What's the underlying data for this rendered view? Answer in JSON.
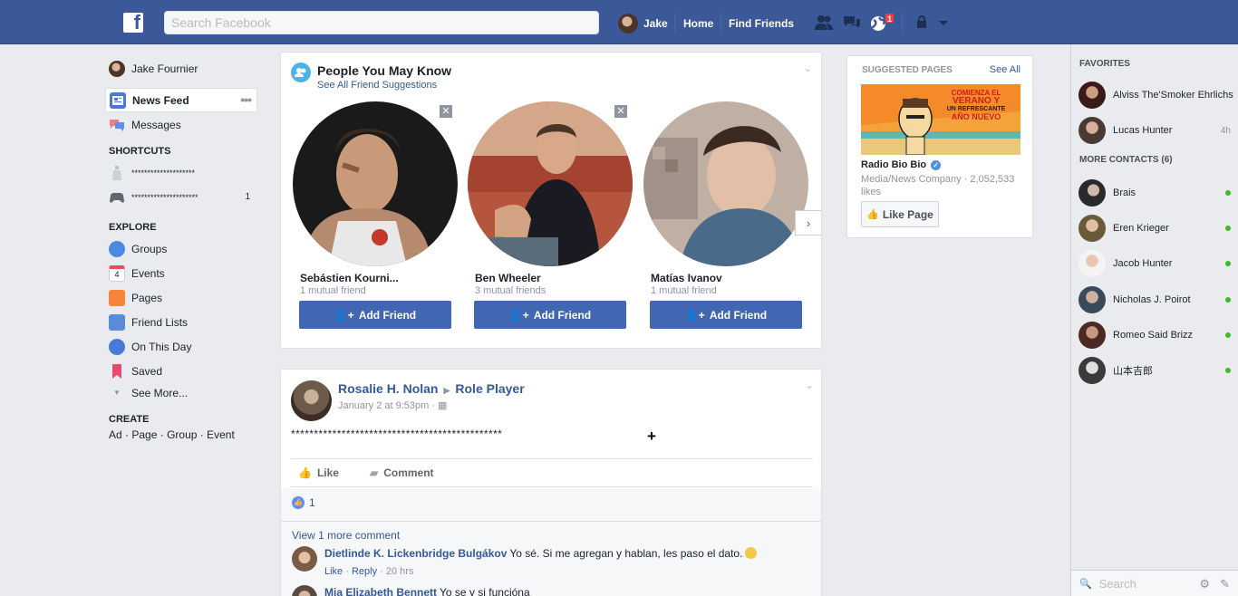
{
  "topbar": {
    "logo_letter": "f",
    "search_placeholder": "Search Facebook",
    "user_name": "Jake",
    "home_label": "Home",
    "find_friends_label": "Find Friends",
    "notification_count": "1"
  },
  "leftnav": {
    "profile_name": "Jake Fournier",
    "news_feed": "News Feed",
    "messages": "Messages",
    "shortcuts_heading": "SHORTCUTS",
    "shortcuts": [
      {
        "label": "********************",
        "count": ""
      },
      {
        "label": "*********************",
        "count": "1"
      }
    ],
    "explore_heading": "EXPLORE",
    "explore": [
      {
        "label": "Groups",
        "icon": "groups-icon",
        "color": "#4a8ae2"
      },
      {
        "label": "Events",
        "icon": "events-icon",
        "color": "#e84a5f"
      },
      {
        "label": "Pages",
        "icon": "pages-icon",
        "color": "#f5843a"
      },
      {
        "label": "Friend Lists",
        "icon": "friend-lists-icon",
        "color": "#5a8ad8"
      },
      {
        "label": "On This Day",
        "icon": "on-this-day-icon",
        "color": "#4a7ad8"
      },
      {
        "label": "Saved",
        "icon": "saved-icon",
        "color": "#e84a6f"
      },
      {
        "label": "See More...",
        "icon": "chevron-down-icon",
        "color": "#90949c"
      }
    ],
    "create_heading": "CREATE",
    "create_links": [
      "Ad",
      "Page",
      "Group",
      "Event"
    ]
  },
  "pymk": {
    "title": "People You May Know",
    "subtitle": "See All Friend Suggestions",
    "people": [
      {
        "name": "Sebástien Kourni...",
        "mutual": "1 mutual friend",
        "button": "Add Friend"
      },
      {
        "name": "Ben Wheeler",
        "mutual": "3 mutual friends",
        "button": "Add Friend"
      },
      {
        "name": "Matías Ivanov",
        "mutual": "1 mutual friend",
        "button": "Add Friend"
      }
    ]
  },
  "post": {
    "author": "Rosalie H. Nolan",
    "target": "Role Player",
    "timestamp": "January 2 at 9:53pm",
    "text": "**********************************************",
    "plus": "+",
    "like_label": "Like",
    "comment_label": "Comment",
    "like_count": "1",
    "view_more": "View 1 more comment",
    "comments": [
      {
        "name": "Dietlinde K. Lickenbridge Bulgákov",
        "text": "Yo sé. Si me agregan y hablan, les paso el dato.",
        "like": "Like",
        "reply": "Reply",
        "time": "20 hrs"
      },
      {
        "name": "Mia Elizabeth Bennett",
        "text": "Yo se y si funcióna",
        "like": "",
        "reply": "",
        "time": ""
      }
    ]
  },
  "suggested_pages": {
    "heading": "SUGGESTED PAGES",
    "see_all": "See All",
    "ad_line1": "COMIENZA EL",
    "ad_line2": "VERANO Y",
    "ad_line3": "UN REFRESCANTE",
    "ad_line4": "AÑO NUEVO",
    "page_name": "Radio Bio Bio",
    "category": "Media/News Company · 2,052,533 likes",
    "like_button": "Like Page"
  },
  "chat": {
    "favorites_heading": "FAVORITES",
    "favorites": [
      {
        "name": "Alviss The'Smoker Ehrlichs",
        "time": "",
        "online": false
      },
      {
        "name": "Lucas Hunter",
        "time": "4h",
        "online": false
      }
    ],
    "more_heading": "MORE CONTACTS (6)",
    "contacts": [
      {
        "name": "Brais",
        "online": true
      },
      {
        "name": "Eren Krieger",
        "online": true
      },
      {
        "name": "Jacob Hunter",
        "online": true
      },
      {
        "name": "Nicholas J. Poirot",
        "online": true
      },
      {
        "name": "Romeo Said Brizz",
        "online": true
      },
      {
        "name": "山本吉郎",
        "online": true
      }
    ],
    "search_placeholder": "Search"
  },
  "colors": {
    "brand": "#3b5998",
    "button_blue": "#4267b2",
    "link": "#365899",
    "online": "#42b72a",
    "badge": "#fa3e3e"
  }
}
